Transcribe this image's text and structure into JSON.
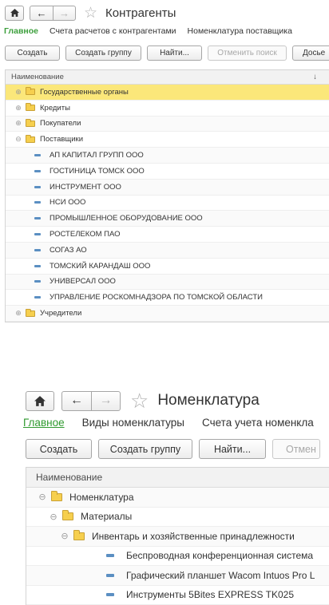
{
  "panel1": {
    "title": "Контрагенты",
    "nav": [
      "Главное",
      "Счета расчетов с контрагентами",
      "Номенклатура поставщика"
    ],
    "buttons": {
      "create": "Создать",
      "create_group": "Создать группу",
      "find": "Найти...",
      "cancel_search": "Отменить поиск",
      "more": "Досье"
    },
    "column": "Наименование",
    "sort_marker": "↓",
    "rows": [
      {
        "label": "Государственные органы",
        "kind": "group",
        "state": "collapsed",
        "selected": true
      },
      {
        "label": "Кредиты",
        "kind": "group",
        "state": "collapsed"
      },
      {
        "label": "Покупатели",
        "kind": "group",
        "state": "collapsed"
      },
      {
        "label": "Поставщики",
        "kind": "group",
        "state": "expanded"
      },
      {
        "label": "АП КАПИТАЛ ГРУПП ООО",
        "kind": "item"
      },
      {
        "label": "ГОСТИНИЦА ТОМСК ООО",
        "kind": "item"
      },
      {
        "label": "ИНСТРУМЕНТ ООО",
        "kind": "item"
      },
      {
        "label": "НСИ ООО",
        "kind": "item"
      },
      {
        "label": "ПРОМЫШЛЕННОЕ ОБОРУДОВАНИЕ ООО",
        "kind": "item"
      },
      {
        "label": "РОСТЕЛЕКОМ ПАО",
        "kind": "item"
      },
      {
        "label": "СОГАЗ АО",
        "kind": "item"
      },
      {
        "label": "ТОМСКИЙ КАРАНДАШ ООО",
        "kind": "item"
      },
      {
        "label": "УНИВЕРСАЛ ООО",
        "kind": "item"
      },
      {
        "label": "УПРАВЛЕНИЕ РОСКОМНАДЗОРА ПО ТОМСКОЙ ОБЛАСТИ",
        "kind": "item"
      },
      {
        "label": "Учредители",
        "kind": "group",
        "state": "collapsed"
      }
    ]
  },
  "panel2": {
    "title": "Номенклатура",
    "nav": [
      "Главное",
      "Виды номенклатуры",
      "Счета учета номенкла"
    ],
    "buttons": {
      "create": "Создать",
      "create_group": "Создать группу",
      "find": "Найти...",
      "cancel_search": "Отмен"
    },
    "column": "Наименование",
    "rows": [
      {
        "label": "Номенклатура",
        "kind": "group",
        "state": "expanded",
        "level": 0
      },
      {
        "label": "Материалы",
        "kind": "group",
        "state": "expanded",
        "level": 1
      },
      {
        "label": "Инвентарь и хозяйственные принадлежности",
        "kind": "group",
        "state": "expanded",
        "level": 2
      },
      {
        "label": "Беспроводная конференционная система",
        "kind": "item",
        "level": 3
      },
      {
        "label": "Графический планшет Wacom Intuos Pro L",
        "kind": "item",
        "level": 3
      },
      {
        "label": "Инструменты 5Bites EXPRESS TK025",
        "kind": "item",
        "level": 3
      }
    ]
  },
  "colors": {
    "accent_green": "#3c9f3c",
    "selection_yellow": "#fbe77a",
    "folder_yellow": "#f6cf4e",
    "item_blue": "#5b8fc2"
  },
  "icons": {
    "home": "home-icon",
    "back": "arrow-left-icon",
    "forward": "arrow-right-icon",
    "favorite": "star-icon",
    "group": "folder-icon",
    "item": "item-dash-icon",
    "expand": "plus-circle-icon",
    "collapse": "minus-circle-icon"
  }
}
